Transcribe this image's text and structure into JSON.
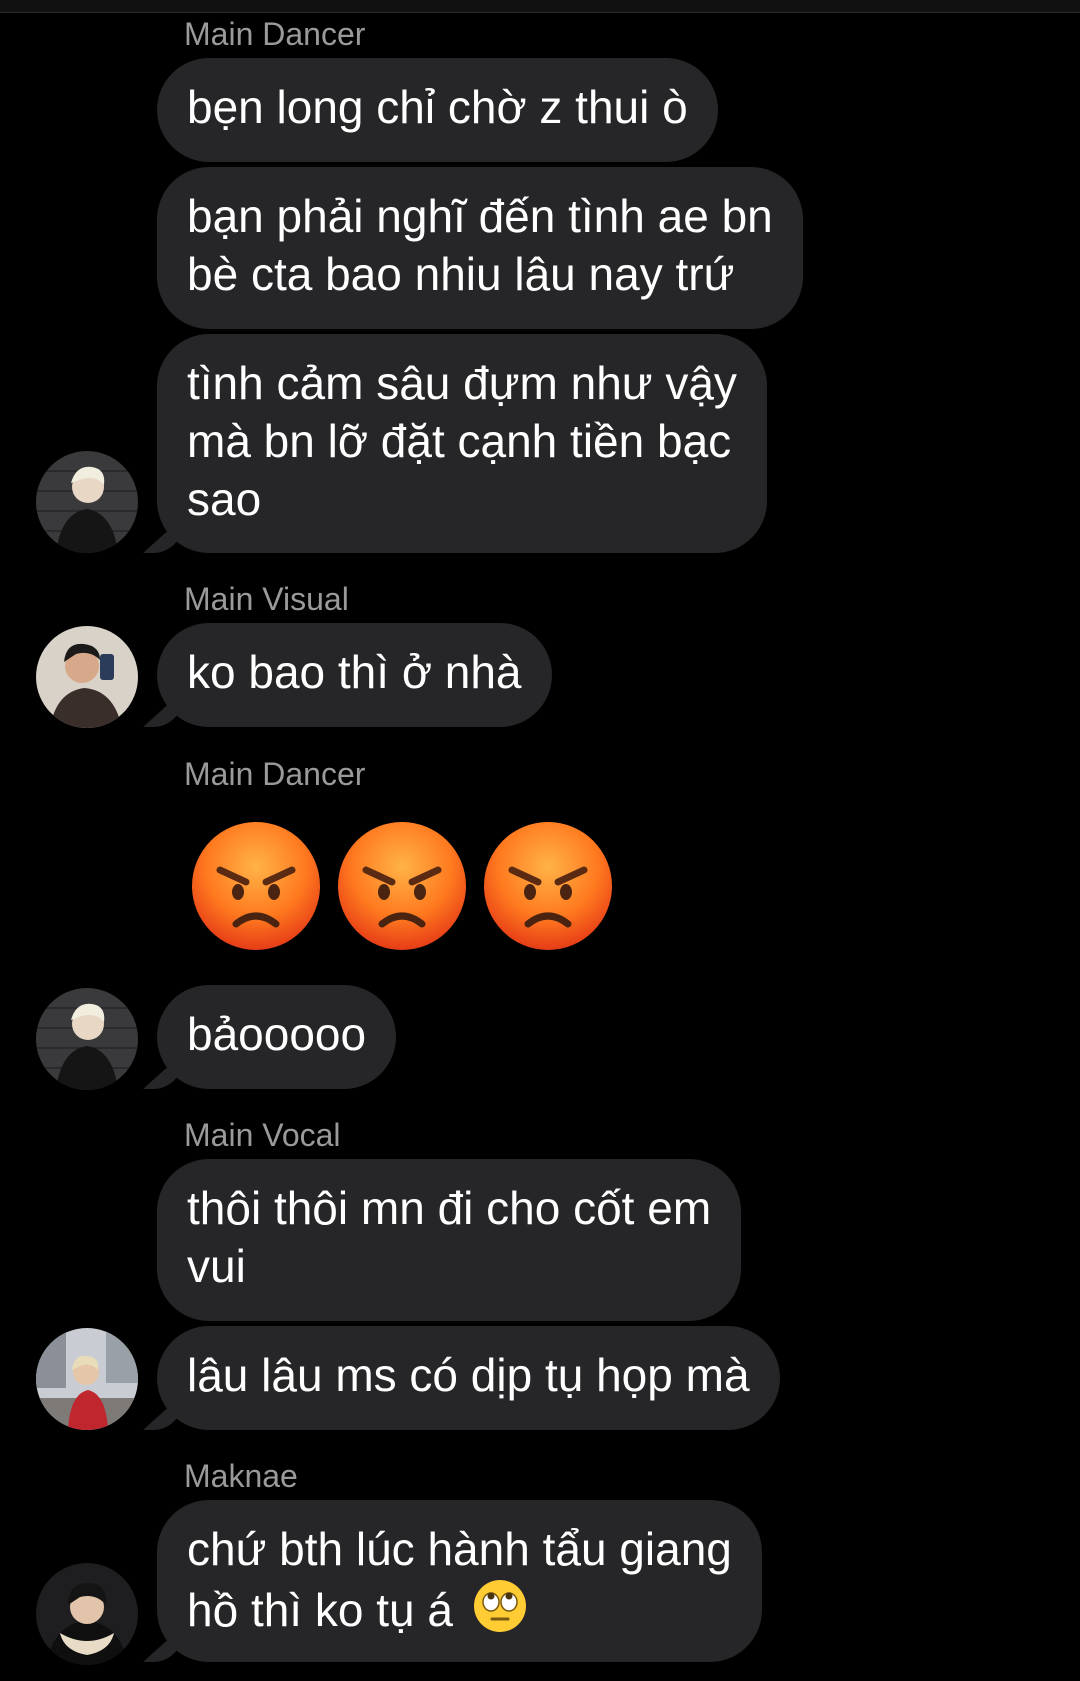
{
  "colors": {
    "background": "#000000",
    "bubble": "#262628",
    "sender_name": "#9a9a9a",
    "text": "#ffffff"
  },
  "messages": [
    {
      "sender": "Main Dancer"
    },
    {
      "text": "bẹn long chỉ chờ z thui ò"
    },
    {
      "line1": "bạn phải nghĩ đến tình ae bn",
      "line2": "bè cta bao nhiu lâu nay trứ"
    },
    {
      "line1": "tình cảm sâu đựm như vậy",
      "line2": "mà bn lỡ đặt cạnh tiền bạc",
      "line3": "sao"
    },
    {
      "sender": "Main Visual"
    },
    {
      "text": "ko bao thì ở nhà"
    },
    {
      "sender": "Main Dancer"
    },
    {
      "emoji": [
        "angry-face-icon",
        "angry-face-icon",
        "angry-face-icon"
      ]
    },
    {
      "text": "bảooooo"
    },
    {
      "sender": "Main Vocal"
    },
    {
      "line1": "thôi thôi mn đi cho cốt em",
      "line2": "vui"
    },
    {
      "text": "lâu lâu ms có dịp tụ họp mà"
    },
    {
      "sender": "Maknae"
    },
    {
      "line1": "chứ bth lúc hành tẩu giang",
      "line2": "hồ thì ko tụ á",
      "inline_emoji": "eye-roll-face-icon"
    }
  ]
}
